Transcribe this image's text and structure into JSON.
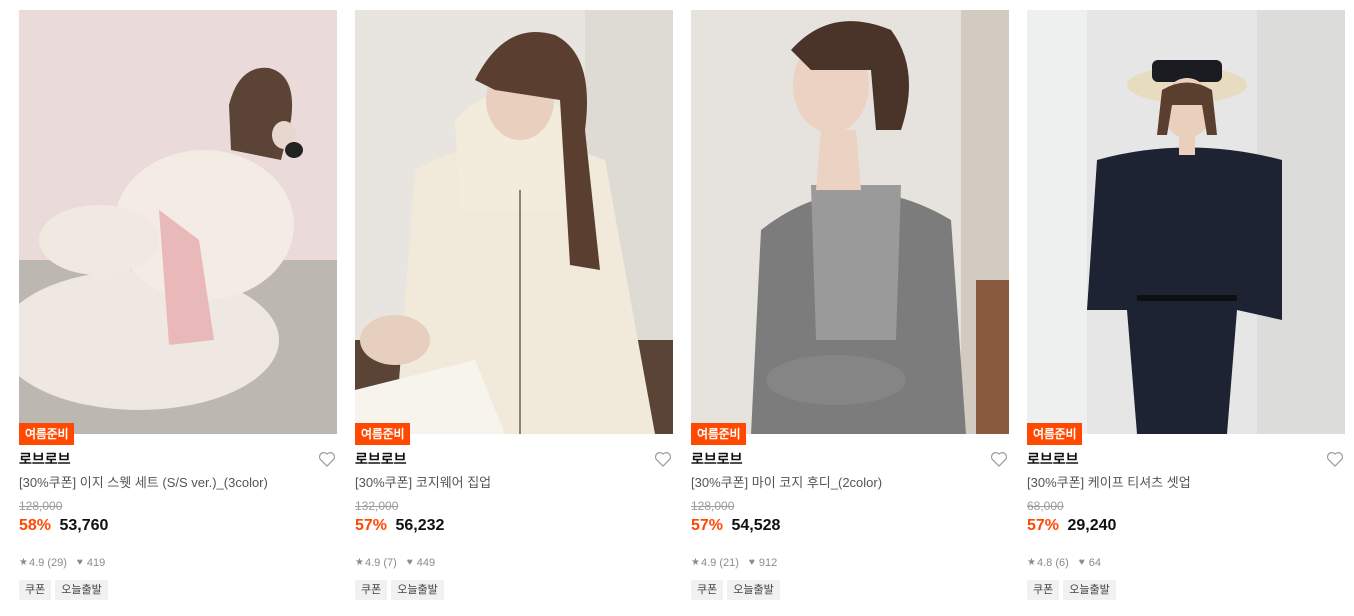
{
  "products": [
    {
      "badge": "여름준비",
      "brand": "로브로브",
      "title": "[30%쿠폰] 이지 스웻 세트 (S/S ver.)_(3color)",
      "original_price": "128,000",
      "discount": "58%",
      "price": "53,760",
      "rating": "4.9",
      "reviews": "(29)",
      "likes": "419",
      "tags": [
        "쿠폰",
        "오늘출발"
      ]
    },
    {
      "badge": "여름준비",
      "brand": "로브로브",
      "title": "[30%쿠폰] 코지웨어 집업",
      "original_price": "132,000",
      "discount": "57%",
      "price": "56,232",
      "rating": "4.9",
      "reviews": "(7)",
      "likes": "449",
      "tags": [
        "쿠폰",
        "오늘출발"
      ]
    },
    {
      "badge": "여름준비",
      "brand": "로브로브",
      "title": "[30%쿠폰] 마이 코지 후디_(2color)",
      "original_price": "128,000",
      "discount": "57%",
      "price": "54,528",
      "rating": "4.9",
      "reviews": "(21)",
      "likes": "912",
      "tags": [
        "쿠폰",
        "오늘출발"
      ]
    },
    {
      "badge": "여름준비",
      "brand": "로브로브",
      "title": "[30%쿠폰] 케이프 티셔츠 셋업",
      "original_price": "68,000",
      "discount": "57%",
      "price": "29,240",
      "rating": "4.8",
      "reviews": "(6)",
      "likes": "64",
      "tags": [
        "쿠폰",
        "오늘출발"
      ]
    }
  ],
  "icons": {
    "wishlist": "heart-outline-icon",
    "rating": "star-icon",
    "likes": "heart-filled-icon"
  },
  "colors": {
    "accent": "#ff4800",
    "muted": "#9b9b9b",
    "tag_bg": "#f1f1f1"
  }
}
